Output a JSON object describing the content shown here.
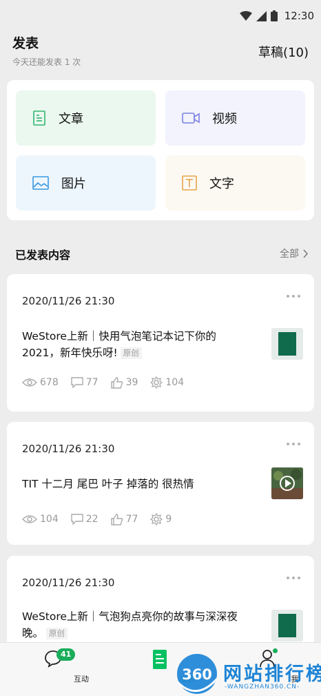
{
  "status": {
    "time": "12:30"
  },
  "header": {
    "title": "发表",
    "subtitle": "今天还能发表 1 次",
    "drafts": "草稿(10)"
  },
  "publish": {
    "article": "文章",
    "video": "视频",
    "image": "图片",
    "text": "文字"
  },
  "section": {
    "title": "已发表内容",
    "all": "全部"
  },
  "posts": [
    {
      "time": "2020/11/26 21:30",
      "title": "WeStore上新｜快用气泡笔记本记下你的2021，新年快乐呀!",
      "badge": "原创",
      "views": "678",
      "comments": "77",
      "likes": "39",
      "shares": "104"
    },
    {
      "time": "2020/11/26 21:30",
      "title": "TIT 十二月 尾巴 叶子 掉落的 很热情",
      "views": "104",
      "comments": "22",
      "likes": "77",
      "shares": "9"
    },
    {
      "time": "2020/11/26 21:30",
      "title": "WeStore上新｜气泡狗点亮你的故事与深深夜晚。",
      "badge": "原创"
    }
  ],
  "tabbar": {
    "interact": "互动",
    "interact_badge": "41",
    "publish": "发表",
    "me": "我"
  },
  "watermark": {
    "logo": "360",
    "title": "网站排行榜",
    "url": "-WANGZHAN360.CN-"
  },
  "colors": {
    "accent": "#07c160",
    "background": "#ededed"
  }
}
